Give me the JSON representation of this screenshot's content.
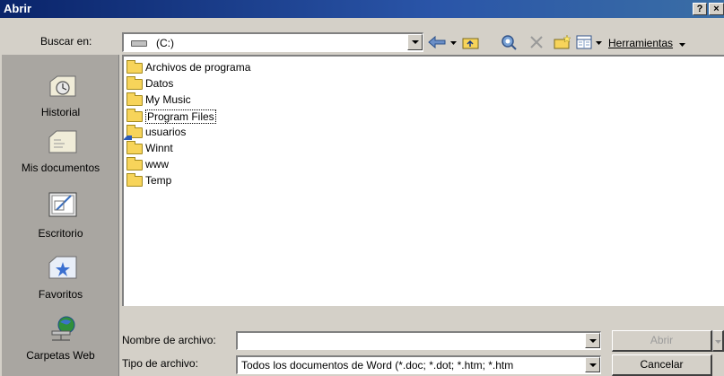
{
  "window": {
    "title": "Abrir",
    "help_label": "?",
    "close_label": "×"
  },
  "toolbar": {
    "look_in_label": "Buscar en:",
    "look_in_value": "(C:)",
    "tools_label": "Herramientas"
  },
  "places": [
    {
      "label": "Historial"
    },
    {
      "label": "Mis documentos"
    },
    {
      "label": "Escritorio"
    },
    {
      "label": "Favoritos"
    },
    {
      "label": "Carpetas Web"
    }
  ],
  "files": [
    {
      "name": "Archivos de programa",
      "icon": "folder-icon"
    },
    {
      "name": "Datos",
      "icon": "folder-icon"
    },
    {
      "name": "My Music",
      "icon": "folder-icon"
    },
    {
      "name": "Program Files",
      "icon": "folder-icon"
    },
    {
      "name": "usuarios",
      "icon": "shared-folder-icon"
    },
    {
      "name": "Winnt",
      "icon": "folder-icon"
    },
    {
      "name": "www",
      "icon": "folder-icon"
    },
    {
      "name": "Temp",
      "icon": "folder-icon"
    }
  ],
  "form": {
    "filename_label": "Nombre de archivo:",
    "filename_value": "",
    "filetype_label": "Tipo de archivo:",
    "filetype_value": "Todos los documentos de Word (*.doc; *.dot; *.htm; *.htm"
  },
  "buttons": {
    "open_label": "Abrir",
    "cancel_label": "Cancelar"
  },
  "colors": {
    "titlebar": "#0a246a",
    "face": "#d4d0c8",
    "places_bg": "#a9a6a1",
    "folder": "#f7d45a"
  }
}
